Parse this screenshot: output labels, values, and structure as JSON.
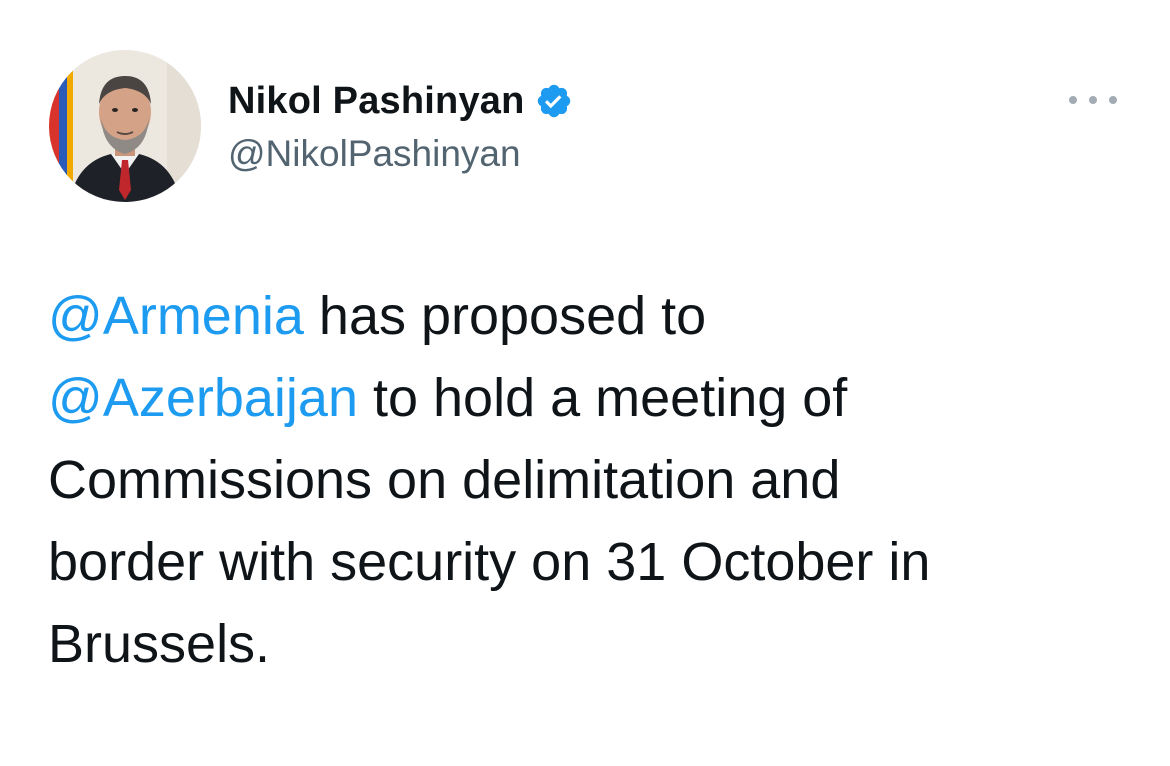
{
  "tweet": {
    "author": {
      "display_name": "Nikol Pashinyan",
      "handle": "@NikolPashinyan",
      "verified": true,
      "avatar_icon": "profile-photo"
    },
    "more_icon": "more-options-icon",
    "text_lines": [
      {
        "mention": "@Armenia",
        "text": " has proposed to"
      },
      {
        "mention": "@Azerbaijan",
        "text": " to hold a meeting of"
      },
      {
        "mention": "",
        "text": "Commissions on delimitation and"
      },
      {
        "mention": "",
        "text": "border with security on 31 October in"
      },
      {
        "mention": "",
        "text": "Brussels."
      }
    ]
  },
  "colors": {
    "mention": "#1d9bf0",
    "verified_badge": "#1d9bf0",
    "handle": "#536471",
    "text": "#0f1419"
  }
}
